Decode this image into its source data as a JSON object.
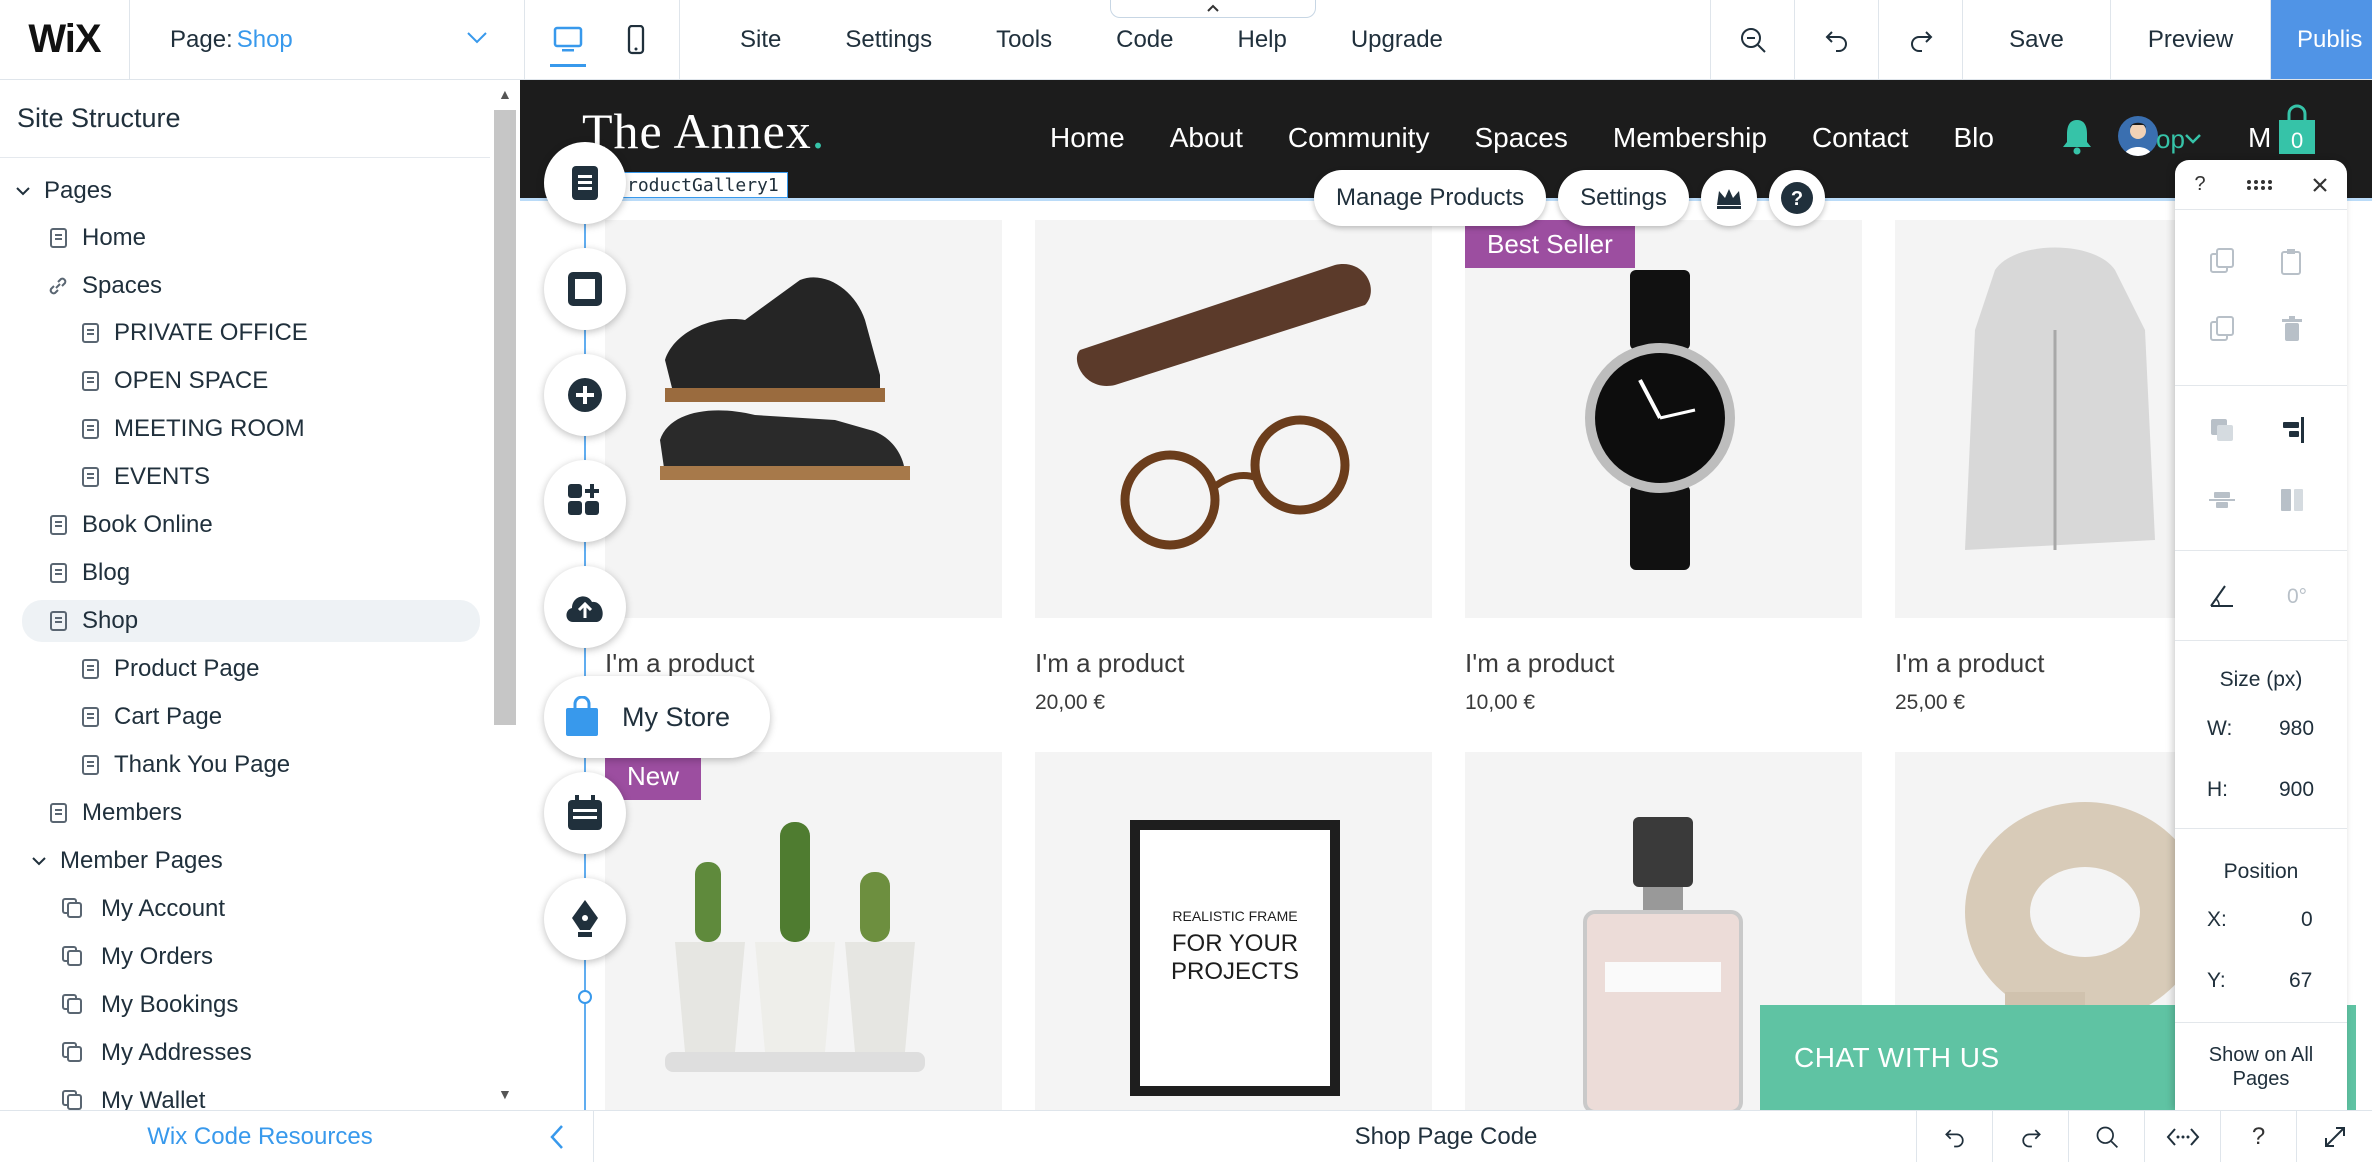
{
  "topbar": {
    "logo": "WiX",
    "page_prefix": "Page:",
    "page_value": "Shop",
    "menu": [
      "Site",
      "Settings",
      "Tools",
      "Code",
      "Help",
      "Upgrade"
    ],
    "save": "Save",
    "preview": "Preview",
    "publish": "Publis"
  },
  "sidebar": {
    "title": "Site Structure",
    "pages_header": "Pages",
    "items": {
      "home": "Home",
      "spaces": "Spaces",
      "private_office": "PRIVATE OFFICE",
      "open_space": "OPEN SPACE",
      "meeting_room": "MEETING ROOM",
      "events": "EVENTS",
      "book_online": "Book Online",
      "blog": "Blog",
      "shop": "Shop",
      "product_page": "Product Page",
      "cart_page": "Cart Page",
      "thank_you_page": "Thank You Page",
      "members": "Members",
      "member_pages": "Member Pages",
      "my_account": "My Account",
      "my_orders": "My Orders",
      "my_bookings": "My Bookings",
      "my_addresses": "My Addresses",
      "my_wallet": "My Wallet"
    },
    "footer": "Wix Code Resources"
  },
  "site": {
    "logo_text": "The Annex",
    "logo_dot": ".",
    "nav": [
      "Home",
      "About",
      "Community",
      "Spaces",
      "Membership",
      "Contact",
      "Blo"
    ],
    "header_overflow": "M",
    "user_fragment": "op",
    "cart_count": "0",
    "component_tag": "roductGallery1",
    "accent": "#36c3a8"
  },
  "floating_actions": {
    "manage_products": "Manage Products",
    "settings": "Settings"
  },
  "products": [
    {
      "name": "I'm a product",
      "price": "",
      "ribbon": ""
    },
    {
      "name": "I'm a product",
      "price": "20,00 €",
      "ribbon": ""
    },
    {
      "name": "I'm a product",
      "price": "10,00 €",
      "ribbon": "Best Seller"
    },
    {
      "name": "I'm a product",
      "price": "25,00 €",
      "ribbon": ""
    },
    {
      "name": "",
      "price": "",
      "ribbon": "New"
    },
    {
      "name": "",
      "price": "",
      "ribbon": ""
    },
    {
      "name": "",
      "price": "",
      "ribbon": ""
    },
    {
      "name": "",
      "price": "",
      "ribbon": ""
    }
  ],
  "frame_text": {
    "line1": "REALISTIC FRAME",
    "line2": "FOR YOUR",
    "line3": "PROJECTS"
  },
  "my_store": "My Store",
  "props_panel": {
    "help": "?",
    "angle": "0°",
    "size_label": "Size (px)",
    "w_label": "W:",
    "w_value": "980",
    "h_label": "H:",
    "h_value": "900",
    "position_label": "Position",
    "x_label": "X:",
    "x_value": "0",
    "y_label": "Y:",
    "y_value": "67",
    "show_all_1": "Show on All",
    "show_all_2": "Pages"
  },
  "chat": "CHAT WITH US",
  "codebar": {
    "title": "Shop Page Code",
    "help": "?"
  },
  "colors": {
    "ribbon": "#9c4ea0",
    "chat": "#5fc3a3",
    "wix_blue": "#3899ec",
    "publish": "#5094e6"
  }
}
